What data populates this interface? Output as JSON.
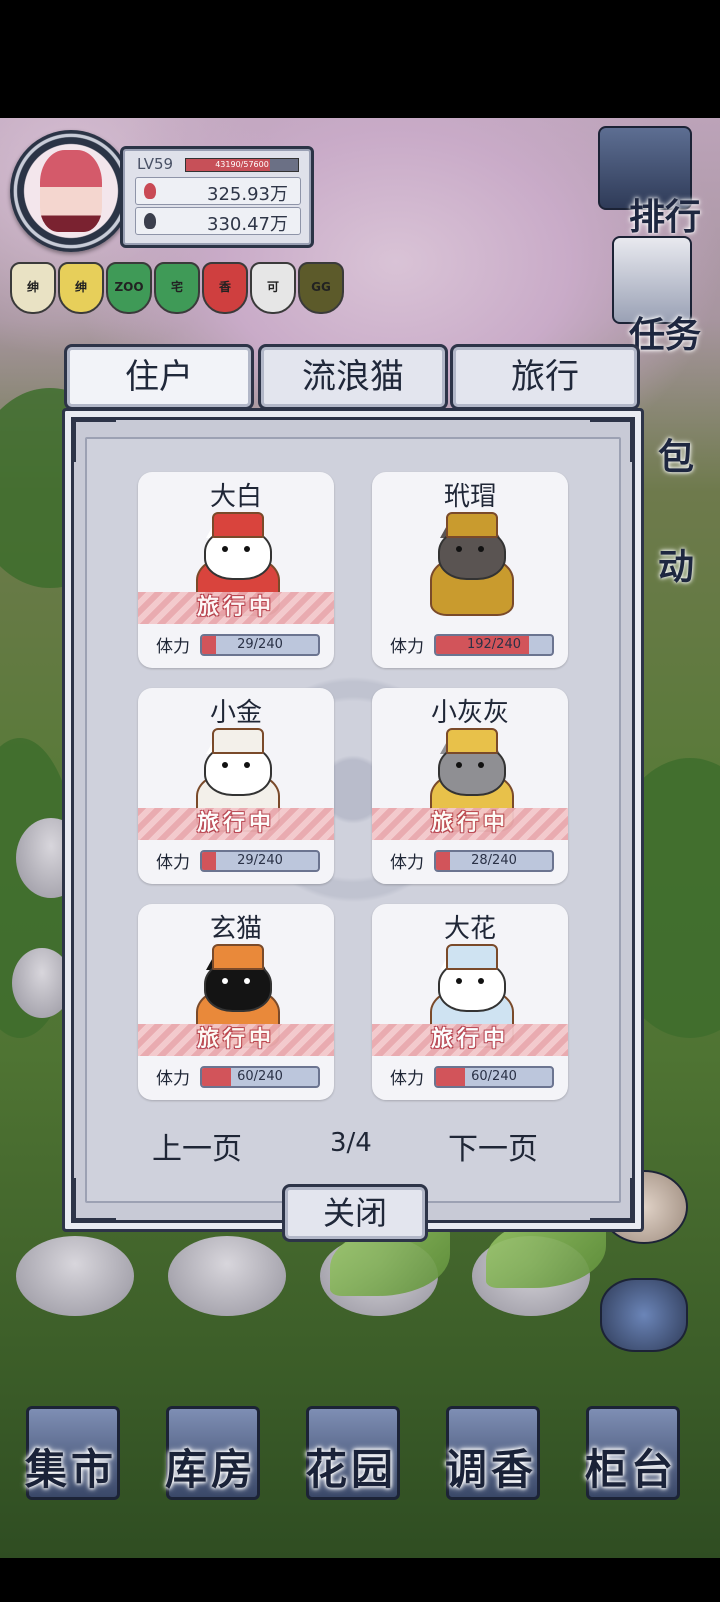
{
  "player": {
    "level": "LV59",
    "xp": "43190/57600",
    "xp_fraction": 0.75,
    "currency_1": "325.93万",
    "currency_2": "330.47万"
  },
  "badges": [
    {
      "label": "绅",
      "color": "#e9e2c4"
    },
    {
      "label": "绅",
      "color": "#e7cf5a"
    },
    {
      "label": "ZOO",
      "color": "#3f9a57"
    },
    {
      "label": "宅",
      "color": "#3f9a57"
    },
    {
      "label": "香",
      "color": "#cf3f3f"
    },
    {
      "label": "可",
      "color": "#e6e6e6"
    },
    {
      "label": "GG",
      "color": "#5c5a2a"
    }
  ],
  "side_menu": {
    "rank": "排行",
    "task": "任务",
    "bag": "包",
    "activity": "动"
  },
  "tabs": [
    {
      "label": "住户",
      "active": true
    },
    {
      "label": "流浪猫",
      "active": false
    },
    {
      "label": "旅行",
      "active": false
    }
  ],
  "cats": [
    {
      "name": "大白",
      "status": "旅行中",
      "stamina_label": "体力",
      "stamina": "29/240",
      "stamina_fraction": 0.121,
      "fur": "#ffffff",
      "outfit": "#d9443d"
    },
    {
      "name": "玳瑁",
      "status": "",
      "stamina_label": "体力",
      "stamina": "192/240",
      "stamina_fraction": 0.8,
      "fur": "#5a5452",
      "outfit": "#c99b2e"
    },
    {
      "name": "小金",
      "status": "旅行中",
      "stamina_label": "体力",
      "stamina": "29/240",
      "stamina_fraction": 0.121,
      "fur": "#ffffff",
      "outfit": "#f3f0ea"
    },
    {
      "name": "小灰灰",
      "status": "旅行中",
      "stamina_label": "体力",
      "stamina": "28/240",
      "stamina_fraction": 0.117,
      "fur": "#8f8f93",
      "outfit": "#e8c14a"
    },
    {
      "name": "玄猫",
      "status": "旅行中",
      "stamina_label": "体力",
      "stamina": "60/240",
      "stamina_fraction": 0.25,
      "fur": "#141414",
      "outfit": "#e9893a"
    },
    {
      "name": "大花",
      "status": "旅行中",
      "stamina_label": "体力",
      "stamina": "60/240",
      "stamina_fraction": 0.25,
      "fur": "#ffffff",
      "outfit": "#cfe3f2"
    }
  ],
  "pagination": {
    "prev": "上一页",
    "page": "3/4",
    "next": "下一页"
  },
  "close": "关闭",
  "bottom_nav": [
    {
      "label": "集市",
      "icon": "market-gate-icon"
    },
    {
      "label": "库房",
      "icon": "warehouse-icon"
    },
    {
      "label": "花园",
      "icon": "rose-icon"
    },
    {
      "label": "调香",
      "icon": "perfume-bottle-icon"
    },
    {
      "label": "柜台",
      "icon": "counter-shelf-icon"
    }
  ]
}
